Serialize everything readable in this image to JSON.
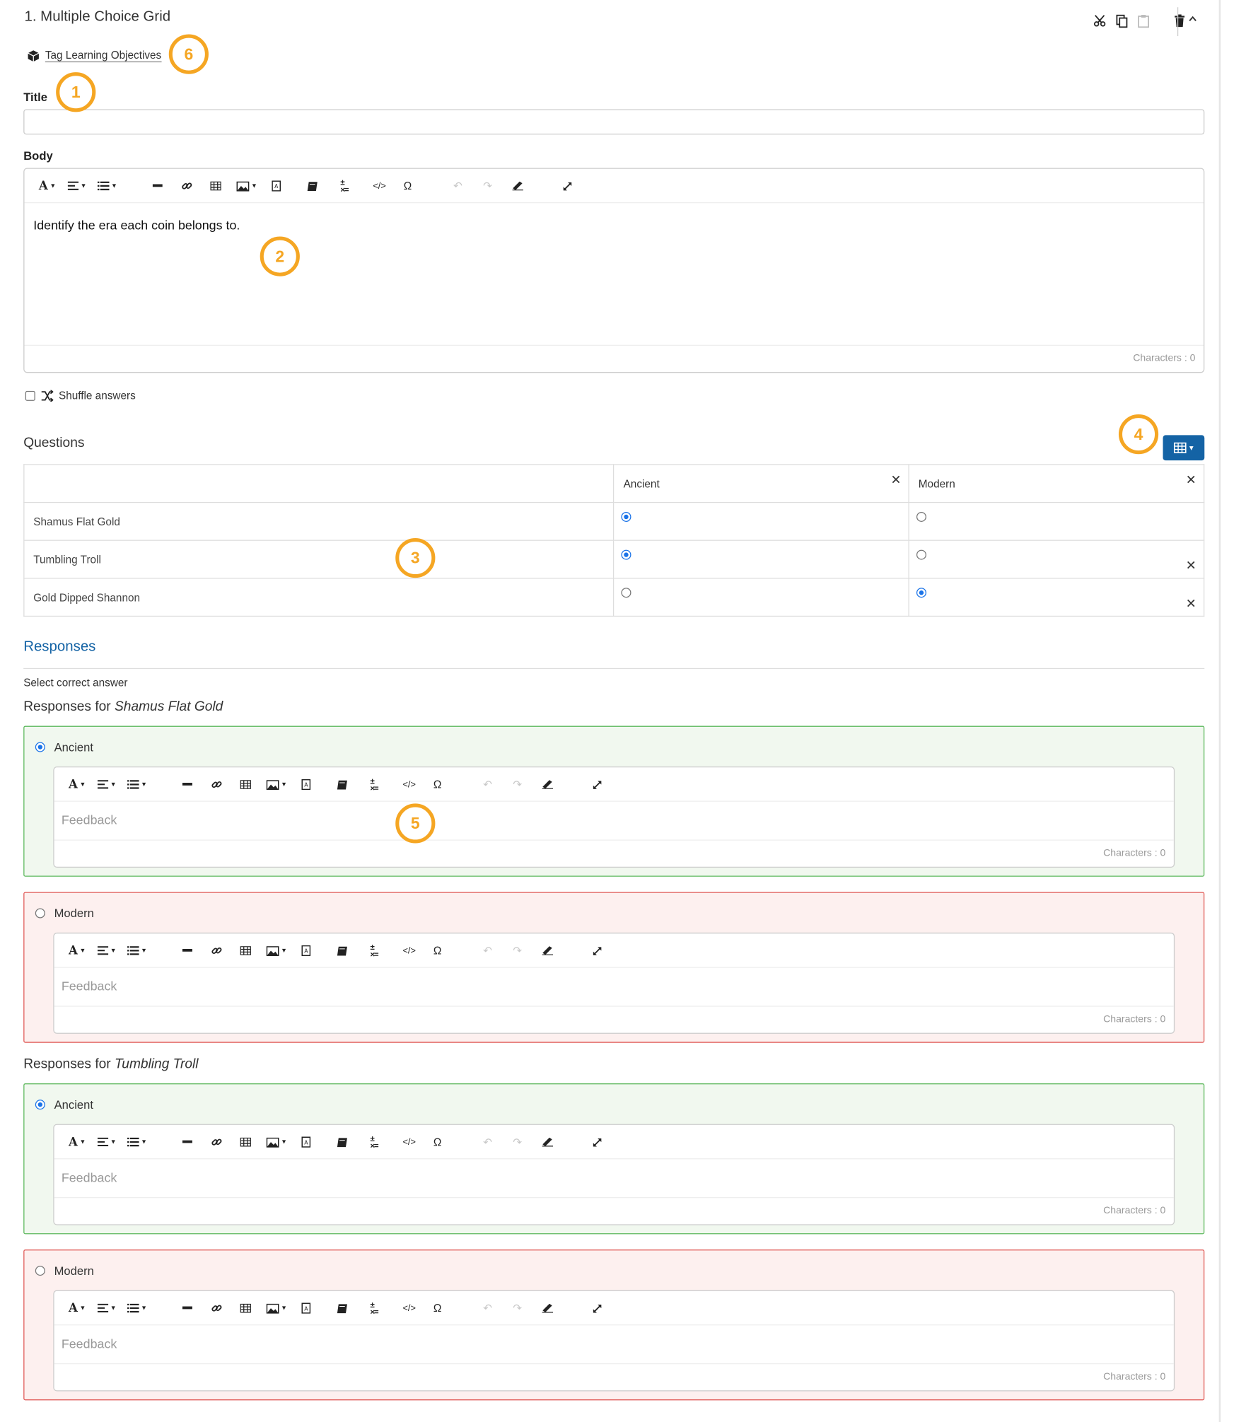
{
  "header": {
    "title": "1. Multiple Choice Grid",
    "tag_learning_objectives": "Tag Learning Objectives"
  },
  "title_field": {
    "label": "Title",
    "value": ""
  },
  "body_field": {
    "label": "Body",
    "content": "Identify the era each coin belongs to.",
    "characters": "Characters : 0"
  },
  "shuffle": {
    "label": "Shuffle answers",
    "checked": false
  },
  "questions": {
    "title": "Questions",
    "columns": [
      "Ancient",
      "Modern"
    ],
    "rows": [
      {
        "label": "Shamus Flat Gold",
        "selected": "Ancient"
      },
      {
        "label": "Tumbling Troll",
        "selected": "Ancient"
      },
      {
        "label": "Gold Dipped Shannon",
        "selected": "Modern"
      }
    ]
  },
  "responses": {
    "title": "Responses",
    "select_correct": "Select correct answer",
    "for_prefix": "Responses for",
    "groups": [
      {
        "question": "Shamus Flat Gold",
        "options": [
          {
            "label": "Ancient",
            "correct": true,
            "feedback_placeholder": "Feedback",
            "characters": "Characters : 0"
          },
          {
            "label": "Modern",
            "correct": false,
            "feedback_placeholder": "Feedback",
            "characters": "Characters : 0"
          }
        ]
      },
      {
        "question": "Tumbling Troll",
        "options": [
          {
            "label": "Ancient",
            "correct": true,
            "feedback_placeholder": "Feedback",
            "characters": "Characters : 0"
          },
          {
            "label": "Modern",
            "correct": false,
            "feedback_placeholder": "Feedback",
            "characters": "Characters : 0"
          }
        ]
      }
    ]
  },
  "callouts": [
    "1",
    "2",
    "3",
    "4",
    "5",
    "6"
  ],
  "colors": {
    "accent": "#1463a5",
    "callout": "#f5a623",
    "correct_border": "#5cb85c",
    "wrong_border": "#e05a57"
  }
}
